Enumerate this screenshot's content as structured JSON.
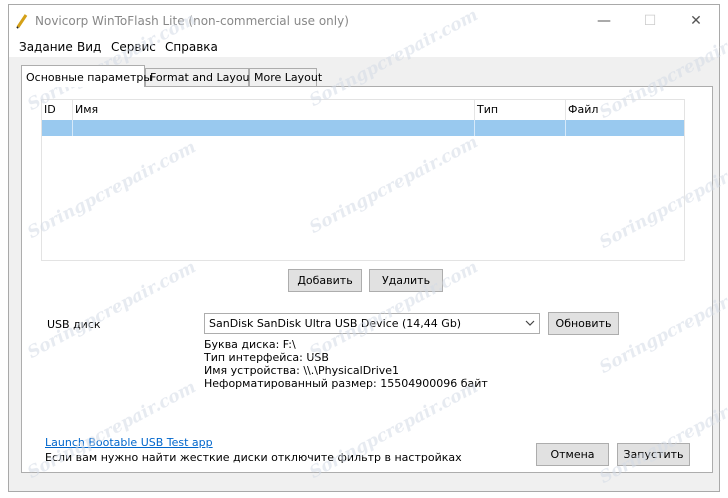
{
  "window": {
    "title": "Novicorp WinToFlash Lite (non-commercial use only)",
    "minimize_glyph": "—",
    "maximize_glyph": "☐",
    "close_glyph": "✕"
  },
  "menu": [
    "Задание",
    "Вид",
    "Сервис",
    "Справка"
  ],
  "tabs": [
    "Основные параметры",
    "Format and Layout",
    "More Layout"
  ],
  "table": {
    "columns": [
      "ID",
      "Имя",
      "Тип",
      "Файл"
    ],
    "rows": []
  },
  "buttons": {
    "add": "Добавить",
    "remove": "Удалить",
    "refresh": "Обновить",
    "cancel": "Отмена",
    "start": "Запустить"
  },
  "usb": {
    "label": "USB диск",
    "selected_device": "SanDisk SanDisk Ultra USB Device (14,44 Gb)",
    "info": [
      "Буква диска: F:\\",
      "Тип интерфейса: USB",
      "Имя устройства: \\\\.\\PhysicalDrive1",
      "Неформатированный размер: 15504900096 байт"
    ]
  },
  "footer": {
    "link": "Launch Bootable USB Test app",
    "hint": "Если вам нужно найти жесткие диски отключите фильтр в настройках"
  },
  "watermark": "Soringpcrepair.com",
  "colors": {
    "selection": "#99c9ef",
    "link": "#0066cc"
  }
}
